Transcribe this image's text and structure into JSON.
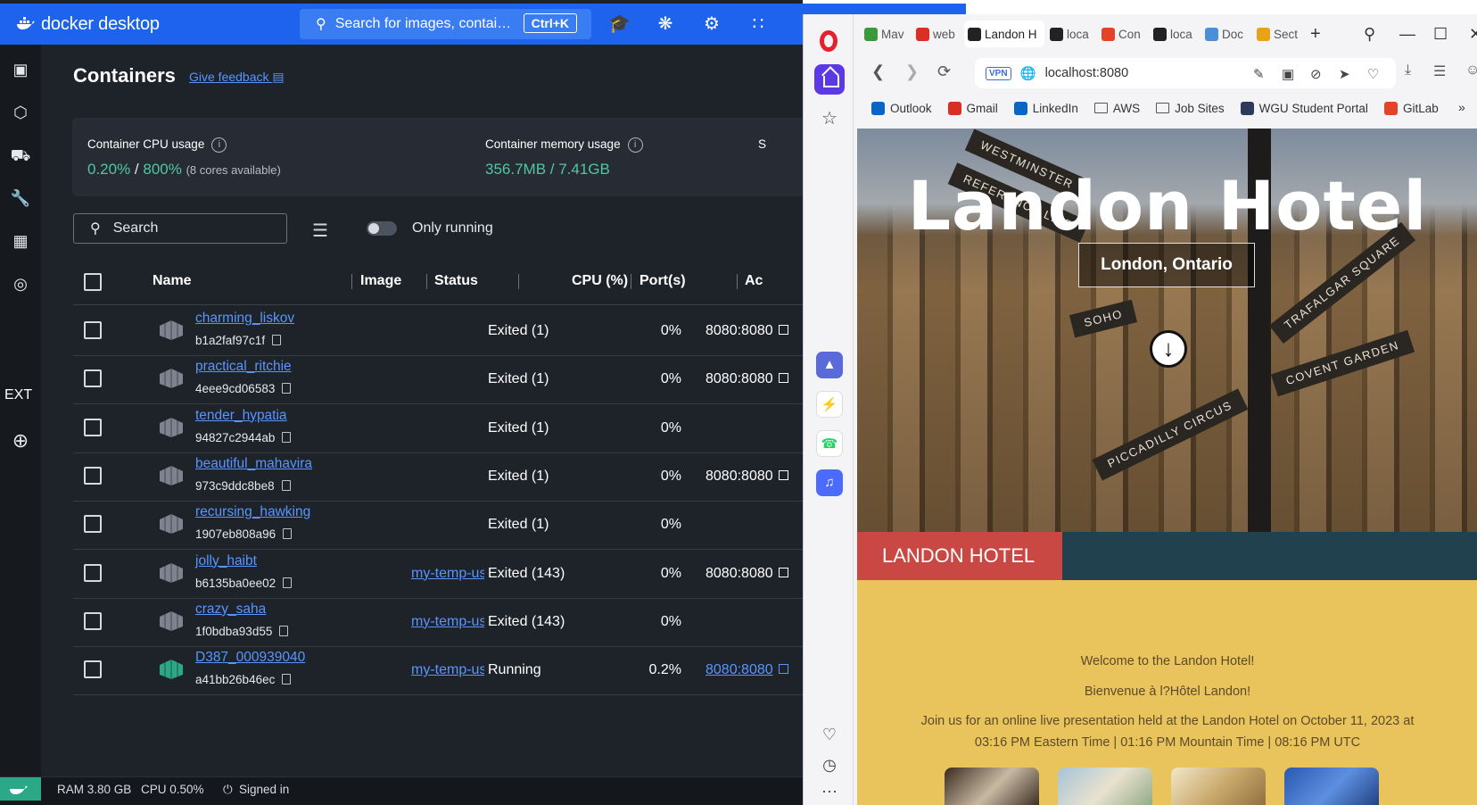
{
  "docker": {
    "brand": "docker desktop",
    "search": {
      "placeholder": "Search for images, contai…",
      "shortcut": "Ctrl+K"
    },
    "title": "Containers",
    "feedback": "Give feedback",
    "cpu": {
      "label": "Container CPU usage",
      "value": "0.20%",
      "total": "800%",
      "note": "(8 cores available)"
    },
    "memory": {
      "label": "Container memory usage",
      "value": "356.7MB / 7.41GB"
    },
    "third_label": "S",
    "list_search": "Search",
    "only_running": "Only running",
    "columns": [
      "Name",
      "Image",
      "Status",
      "CPU (%)",
      "Port(s)",
      "Ac"
    ],
    "rows": [
      {
        "name": "charming_liskov",
        "id": "b1a2faf97c1f",
        "image": "",
        "status": "Exited (1)",
        "cpu": "0%",
        "port": "8080:8080",
        "running": false
      },
      {
        "name": "practical_ritchie",
        "id": "4eee9cd06583",
        "image": "",
        "status": "Exited (1)",
        "cpu": "0%",
        "port": "8080:8080",
        "running": false
      },
      {
        "name": "tender_hypatia",
        "id": "94827c2944ab",
        "image": "",
        "status": "Exited (1)",
        "cpu": "0%",
        "port": "",
        "running": false
      },
      {
        "name": "beautiful_mahavira",
        "id": "973c9ddc8be8",
        "image": "",
        "status": "Exited (1)",
        "cpu": "0%",
        "port": "8080:8080",
        "running": false
      },
      {
        "name": "recursing_hawking",
        "id": "1907eb808a96",
        "image": "",
        "status": "Exited (1)",
        "cpu": "0%",
        "port": "",
        "running": false
      },
      {
        "name": "jolly_haibt",
        "id": "b6135ba0ee02",
        "image": "my-temp-us",
        "status": "Exited (143)",
        "cpu": "0%",
        "port": "8080:8080",
        "running": false
      },
      {
        "name": "crazy_saha",
        "id": "1f0bdba93d55",
        "image": "my-temp-us",
        "status": "Exited (143)",
        "cpu": "0%",
        "port": "",
        "running": false
      },
      {
        "name": "D387_000939040",
        "id": "a41bb26b46ec",
        "image": "my-temp-us",
        "status": "Running",
        "cpu": "0.2%",
        "port": "8080:8080",
        "running": true
      }
    ],
    "statusbar": {
      "ram": "RAM 3.80 GB",
      "cpu": "CPU 0.50%",
      "signed": "Signed in"
    },
    "rail_ext": "EXT",
    "colors": {
      "accent": "#1d63ed",
      "link": "#5896ff",
      "green": "#4fc7a5"
    }
  },
  "browser": {
    "tabs": [
      {
        "label": "Mav",
        "icon": "opera-gx",
        "color": "#3a9a3a"
      },
      {
        "label": "web",
        "icon": "gmail",
        "color": "#d93025"
      },
      {
        "label": "Landon H",
        "icon": "angular",
        "color": "#222",
        "active": true
      },
      {
        "label": "loca",
        "icon": "angular",
        "color": "#222"
      },
      {
        "label": "Con",
        "icon": "gitlab",
        "color": "#e24329"
      },
      {
        "label": "loca",
        "icon": "angular",
        "color": "#222"
      },
      {
        "label": "Doc",
        "icon": "chrome",
        "color": "#4a90d9"
      },
      {
        "label": "Sect",
        "icon": "zybooks",
        "color": "#e8a21a"
      }
    ],
    "url": "localhost:8080",
    "vpn": "VPN",
    "bookmarks": [
      "Outlook",
      "Gmail",
      "LinkedIn",
      "AWS",
      "Job Sites",
      "WGU Student Portal",
      "GitLab"
    ]
  },
  "site": {
    "title": "Landon Hotel",
    "subtitle": "London, Ontario",
    "band_label": "LANDON HOTEL",
    "signs": [
      "WESTMINSTER",
      "REFERENCE LIBR",
      "TRAFALGAR SQUARE",
      "COVENT GARDEN",
      "SOHO",
      "PICCADILLY CIRCUS"
    ],
    "welcome_en": "Welcome to the Landon Hotel!",
    "welcome_fr": "Bienvenue à l?Hôtel Landon!",
    "event": "Join us for an online live presentation held at the Landon Hotel on October 11, 2023 at 03:16 PM Eastern Time | 01:16 PM Mountain Time | 08:16 PM UTC"
  }
}
